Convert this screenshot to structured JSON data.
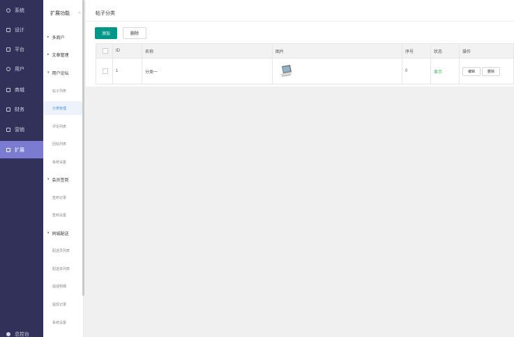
{
  "nav": {
    "items": [
      {
        "label": "系统",
        "icon": "gear-icon"
      },
      {
        "label": "设计",
        "icon": "design-icon"
      },
      {
        "label": "平台",
        "icon": "platform-icon"
      },
      {
        "label": "用户",
        "icon": "user-icon"
      },
      {
        "label": "商城",
        "icon": "shop-icon"
      },
      {
        "label": "财务",
        "icon": "finance-icon"
      },
      {
        "label": "营销",
        "icon": "marketing-icon"
      },
      {
        "label": "扩展",
        "icon": "extend-icon"
      }
    ],
    "active": "扩展",
    "bottom_label": "总控台"
  },
  "submenu": {
    "title": "扩展功能",
    "collapse_glyph": "«",
    "groups": [
      {
        "label": "多商户",
        "expanded": false,
        "children": []
      },
      {
        "label": "文章管理",
        "expanded": false,
        "children": []
      },
      {
        "label": "用户论坛",
        "expanded": true,
        "children": [
          "帖子列表",
          "分类管理",
          "评论列表",
          "回帖列表",
          "系统设置"
        ]
      },
      {
        "label": "会员签到",
        "expanded": true,
        "children": [
          "签到记录",
          "签到设置"
        ]
      },
      {
        "label": "同城配送",
        "expanded": true,
        "children": [
          "配送员列表",
          "配送单列表",
          "提成明细",
          "提现记录",
          "系统设置"
        ]
      }
    ],
    "active_child": "分类管理"
  },
  "page": {
    "breadcrumb": "帖子分类",
    "add_label": "添加",
    "delete_label": "删除"
  },
  "table": {
    "columns": [
      "ID",
      "名称",
      "图片",
      "序号",
      "状态",
      "操作"
    ],
    "rows": [
      {
        "id": "1",
        "name": "分类一",
        "image": "laptop-thumbnail",
        "sort": "0",
        "status": "显示",
        "edit_label": "编辑",
        "delete_label": "删除"
      }
    ]
  },
  "colors": {
    "sidebar": "#31315a",
    "active_nav": "#7b7cd1",
    "primary": "#009688",
    "status_show": "#2db34a"
  }
}
